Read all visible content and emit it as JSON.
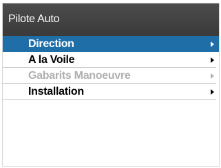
{
  "window": {
    "title": "Pilote Auto"
  },
  "menu": {
    "items": [
      {
        "label": "Direction",
        "state": "selected"
      },
      {
        "label": "A la Voile",
        "state": "normal"
      },
      {
        "label": "Gabarits Manoeuvre",
        "state": "disabled"
      },
      {
        "label": "Installation",
        "state": "normal"
      }
    ]
  },
  "colors": {
    "title_bar": "#3f3f3f",
    "selection": "#1f6ea8",
    "disabled_text": "#b0b0b0"
  },
  "icons": {
    "submenu_arrow": "chevron-right-icon"
  }
}
